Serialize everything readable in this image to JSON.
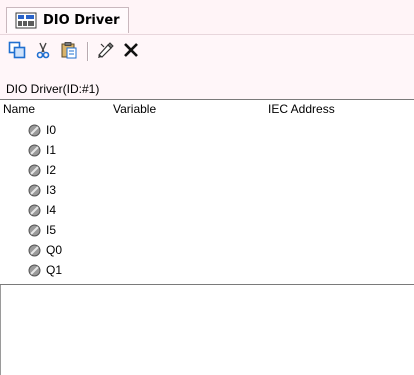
{
  "tab": {
    "title": "DIO Driver",
    "icon": "dio-driver-icon"
  },
  "toolbar": {
    "buttons": [
      {
        "name": "copy-button",
        "icon": "copy-icon"
      },
      {
        "name": "cut-button",
        "icon": "scissors-icon"
      },
      {
        "name": "paste-button",
        "icon": "clipboard-icon"
      },
      {
        "name": "edit-button",
        "icon": "pen-icon"
      },
      {
        "name": "delete-button",
        "icon": "close-icon"
      }
    ]
  },
  "panel": {
    "title": "DIO Driver(ID:#1)"
  },
  "table": {
    "headers": [
      "Name",
      "Variable",
      "IEC Address"
    ],
    "rows": [
      {
        "name": "I0",
        "variable": "",
        "iec": ""
      },
      {
        "name": "I1",
        "variable": "",
        "iec": ""
      },
      {
        "name": "I2",
        "variable": "",
        "iec": ""
      },
      {
        "name": "I3",
        "variable": "",
        "iec": ""
      },
      {
        "name": "I4",
        "variable": "",
        "iec": ""
      },
      {
        "name": "I5",
        "variable": "",
        "iec": ""
      },
      {
        "name": "Q0",
        "variable": "",
        "iec": ""
      },
      {
        "name": "Q1",
        "variable": "",
        "iec": ""
      }
    ]
  },
  "colors": {
    "accent_blue": "#1f6fd0",
    "chrome_bg": "#fff6f9",
    "pin_gray": "#8a8a8a"
  }
}
